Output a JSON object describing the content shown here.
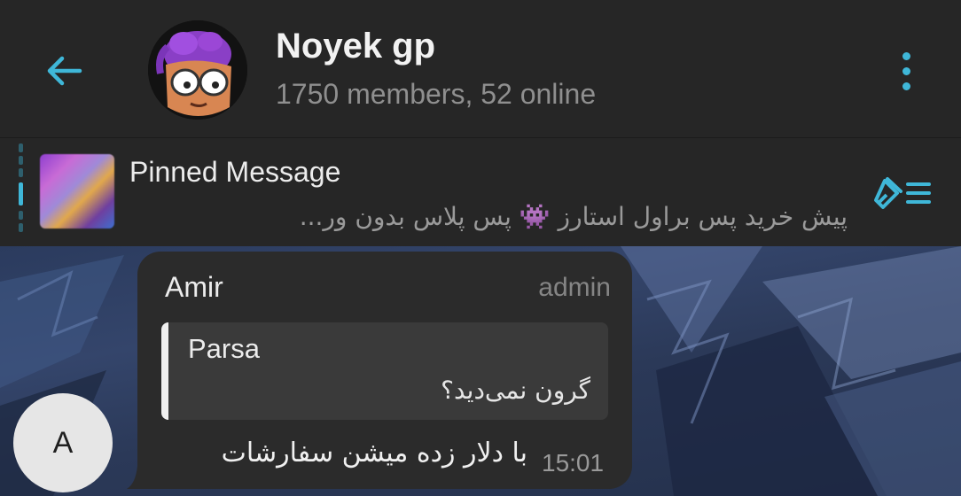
{
  "header": {
    "title": "Noyek gp",
    "subtitle": "1750 members, 52 online",
    "back_icon": "arrow-left-icon",
    "menu_icon": "more-vertical-icon",
    "accent_color": "#3fb7d8"
  },
  "pinned": {
    "title": "Pinned Message",
    "text": "پیش خرید پس براول استارز 👾 پس پلاس بدون ور...",
    "list_icon": "pinned-list-icon"
  },
  "message": {
    "sender_initial": "A",
    "sender_name": "Amir",
    "sender_role": "admin",
    "reply_name": "Parsa",
    "reply_text": "گرون نمی‌دید؟",
    "text": "با دلار زده میشن سفارشات",
    "time": "15:01"
  }
}
